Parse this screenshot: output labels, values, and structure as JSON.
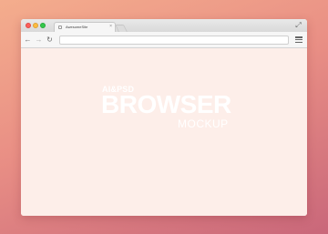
{
  "colors": {
    "background_top": "#f4ad8d",
    "background_bottom": "#c9677a",
    "page_background": "#fdeee9",
    "close": "#fc605c",
    "minimize": "#fdbc40",
    "maximize": "#34c84a"
  },
  "titlebar": {
    "traffic_lights": [
      "close-dot",
      "minimize-dot",
      "maximize-dot"
    ],
    "tab": {
      "title": "AwesomeSite",
      "close_label": "×"
    },
    "fullscreen_label": "⤢"
  },
  "toolbar": {
    "back_label": "←",
    "forward_label": "→",
    "reload_label": "↻",
    "address_value": ""
  },
  "watermark": {
    "line1": "AI&PSD",
    "line2": "BROWSER",
    "line3": "MOCKUP"
  }
}
